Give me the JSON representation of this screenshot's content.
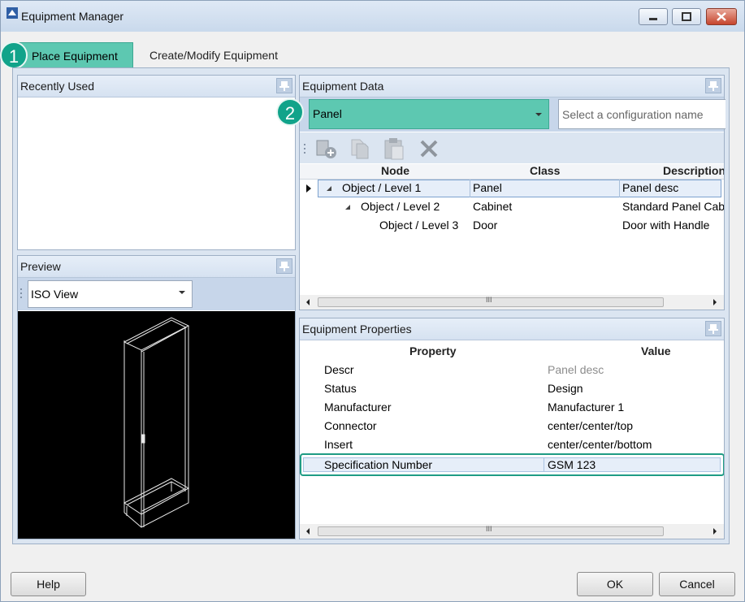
{
  "window": {
    "title": "Equipment Manager"
  },
  "tabs": [
    {
      "label": "Place Equipment"
    },
    {
      "label": "Create/Modify Equipment"
    }
  ],
  "badges": [
    "1",
    "2"
  ],
  "recently_used": {
    "title": "Recently Used"
  },
  "preview": {
    "title": "Preview",
    "view_select": "ISO View"
  },
  "equipment_data": {
    "title": "Equipment Data",
    "type_select": "Panel",
    "config_placeholder": "Select a configuration name",
    "columns": [
      "Node",
      "Class",
      "Description"
    ],
    "rows": [
      {
        "node": "Object / Level 1",
        "class": "Panel",
        "description": "Panel desc"
      },
      {
        "node": "Object / Level 2",
        "class": "Cabinet",
        "description": "Standard Panel Cabinet"
      },
      {
        "node": "Object / Level 3",
        "class": "Door",
        "description": "Door with Handle"
      }
    ]
  },
  "equipment_properties": {
    "title": "Equipment Properties",
    "columns": [
      "Property",
      "Value"
    ],
    "rows": [
      {
        "property": "Descr",
        "value": "Panel desc"
      },
      {
        "property": "Status",
        "value": "Design"
      },
      {
        "property": "Manufacturer",
        "value": "Manufacturer 1"
      },
      {
        "property": "Connector",
        "value": "center/center/top"
      },
      {
        "property": "Insert",
        "value": "center/center/bottom"
      },
      {
        "property": "Specification Number",
        "value": "GSM 123"
      }
    ]
  },
  "scrollbar_grip": "III",
  "buttons": {
    "help": "Help",
    "ok": "OK",
    "cancel": "Cancel"
  },
  "colors": {
    "accent": "#5dc8b1",
    "badge": "#11a38a",
    "highlight_border": "#1f9c84"
  }
}
